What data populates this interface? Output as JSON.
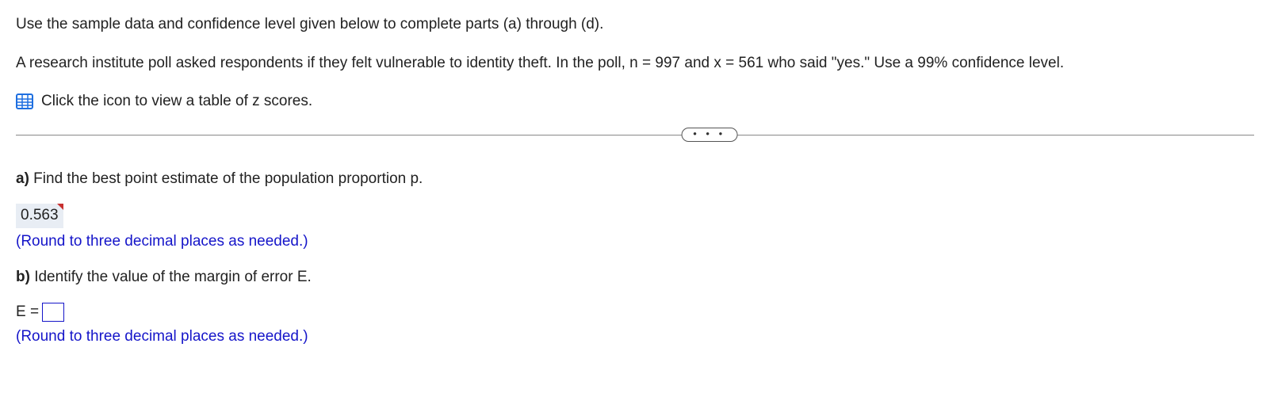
{
  "intro1": "Use the sample data and confidence level given below to complete parts (a) through (d).",
  "intro2": "A research institute poll asked respondents if they felt vulnerable to identity theft. In the poll, n = 997 and x = 561 who said \"yes.\" Use a 99% confidence level.",
  "iconLinkText": "Click the icon to view a table of z scores.",
  "dots": "• • •",
  "partA": {
    "label": "a)",
    "text": " Find the best point estimate of the population proportion p.",
    "answer": "0.563",
    "hint": "(Round to three decimal places as needed.)"
  },
  "partB": {
    "label": "b)",
    "text": " Identify the value of the margin of error E.",
    "eqLeft": "E =",
    "hint": "(Round to three decimal places as needed.)"
  }
}
